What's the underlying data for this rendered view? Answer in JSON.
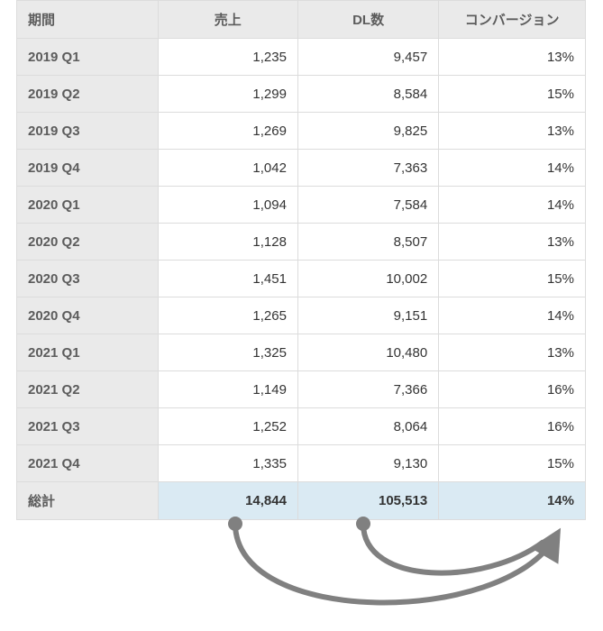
{
  "headers": {
    "period": "期間",
    "sales": "売上",
    "dl": "DL数",
    "conv": "コンバージョン"
  },
  "rows": [
    {
      "period": "2019 Q1",
      "sales": "1,235",
      "dl": "9,457",
      "conv": "13%"
    },
    {
      "period": "2019 Q2",
      "sales": "1,299",
      "dl": "8,584",
      "conv": "15%"
    },
    {
      "period": "2019 Q3",
      "sales": "1,269",
      "dl": "9,825",
      "conv": "13%"
    },
    {
      "period": "2019 Q4",
      "sales": "1,042",
      "dl": "7,363",
      "conv": "14%"
    },
    {
      "period": "2020 Q1",
      "sales": "1,094",
      "dl": "7,584",
      "conv": "14%"
    },
    {
      "period": "2020 Q2",
      "sales": "1,128",
      "dl": "8,507",
      "conv": "13%"
    },
    {
      "period": "2020 Q3",
      "sales": "1,451",
      "dl": "10,002",
      "conv": "15%"
    },
    {
      "period": "2020 Q4",
      "sales": "1,265",
      "dl": "9,151",
      "conv": "14%"
    },
    {
      "period": "2021 Q1",
      "sales": "1,325",
      "dl": "10,480",
      "conv": "13%"
    },
    {
      "period": "2021 Q2",
      "sales": "1,149",
      "dl": "7,366",
      "conv": "16%"
    },
    {
      "period": "2021 Q3",
      "sales": "1,252",
      "dl": "8,064",
      "conv": "16%"
    },
    {
      "period": "2021 Q4",
      "sales": "1,335",
      "dl": "9,130",
      "conv": "15%"
    }
  ],
  "total": {
    "label": "総計",
    "sales": "14,844",
    "dl": "105,513",
    "conv": "14%"
  },
  "arrow_color": "#808080"
}
